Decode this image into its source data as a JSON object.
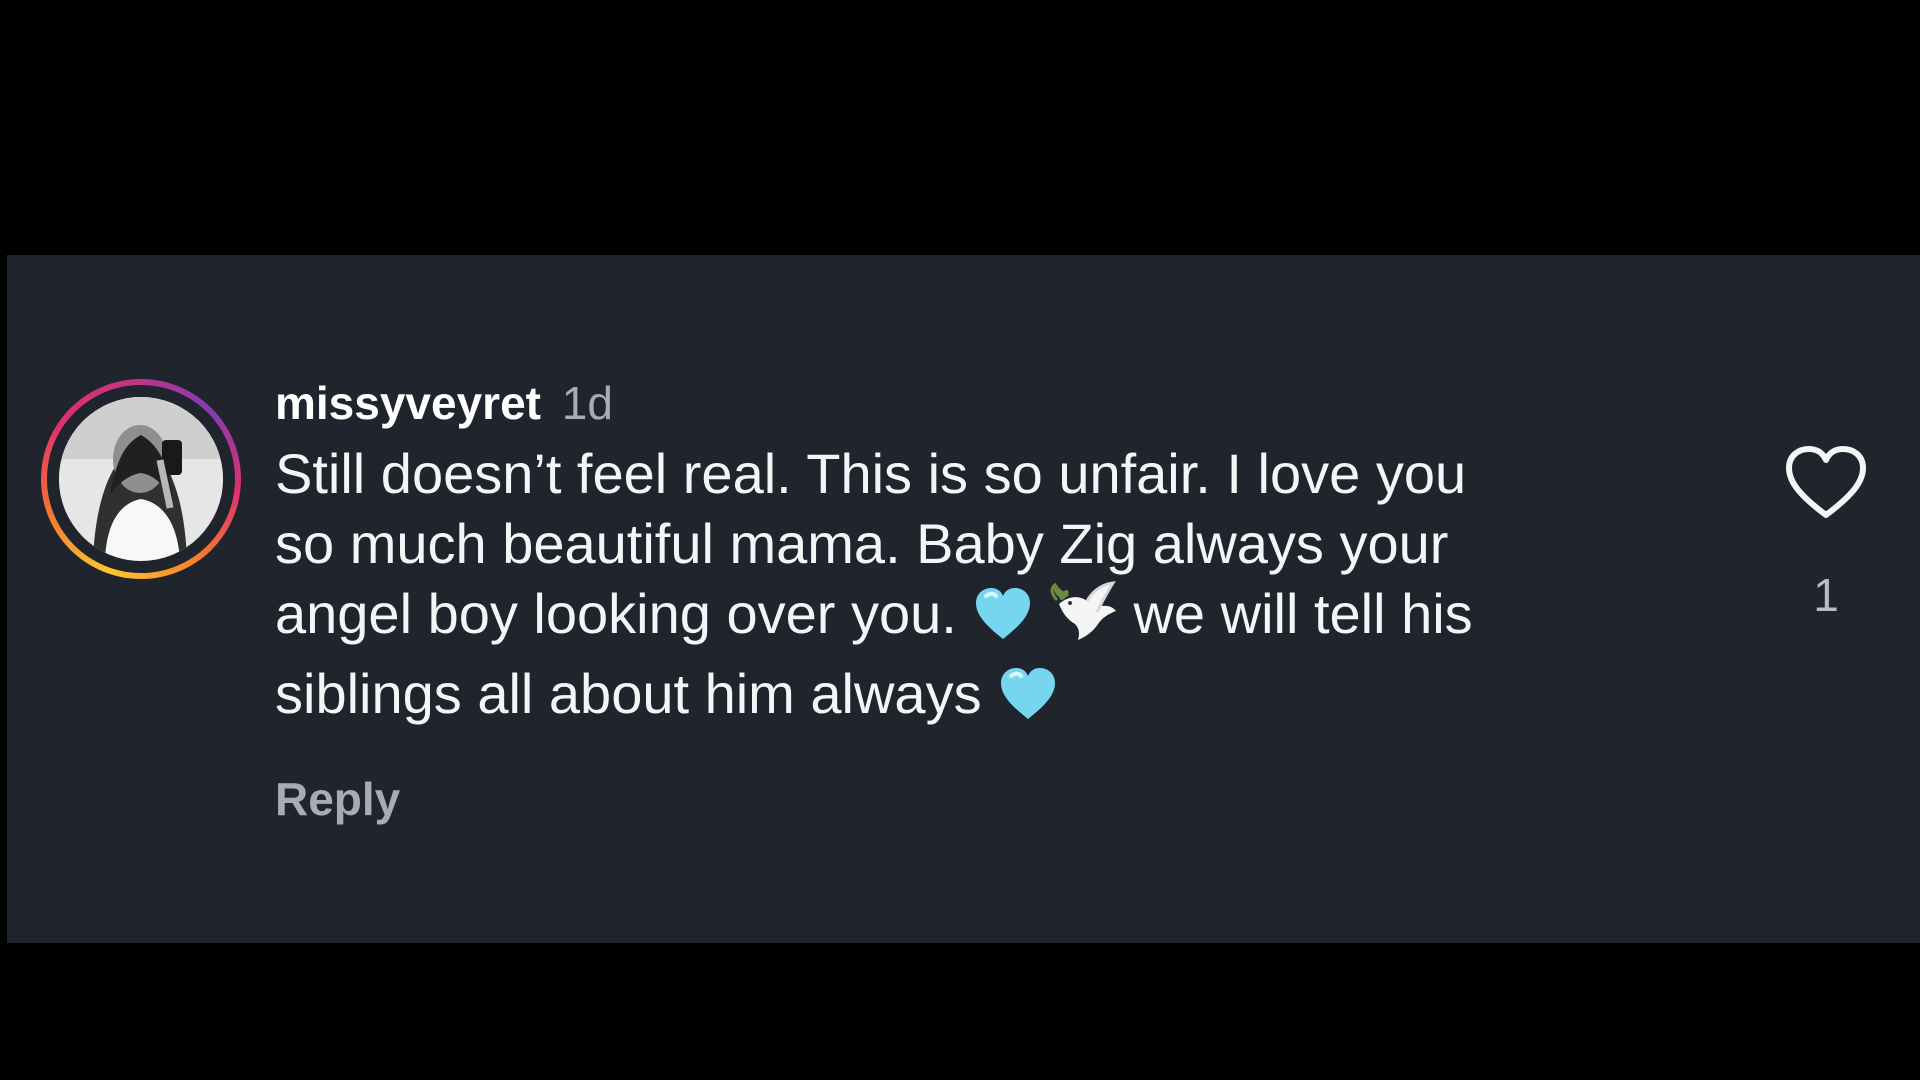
{
  "comment": {
    "username": "missyveyret",
    "timestamp": "1d",
    "text_line_1": "Still doesn’t feel real. This is so unfair. I love you",
    "text_line_2": "so much beautiful mama. Baby Zig always your",
    "text_line_3a": "angel boy looking over you.",
    "text_line_3b": "we will tell his",
    "text_line_4": "siblings all about him always",
    "emojis": [
      "light-blue-heart",
      "dove",
      "light-blue-heart"
    ],
    "reply_label": "Reply",
    "like_count": "1"
  },
  "colors": {
    "panel_background": "#20242c",
    "outer_background": "#000000",
    "text": "#f4f5f7",
    "muted_text": "#a7abb3",
    "heart_emoji": "#76d6f0"
  },
  "icons": {
    "like": "heart-outline-icon",
    "avatar": "user-avatar"
  }
}
